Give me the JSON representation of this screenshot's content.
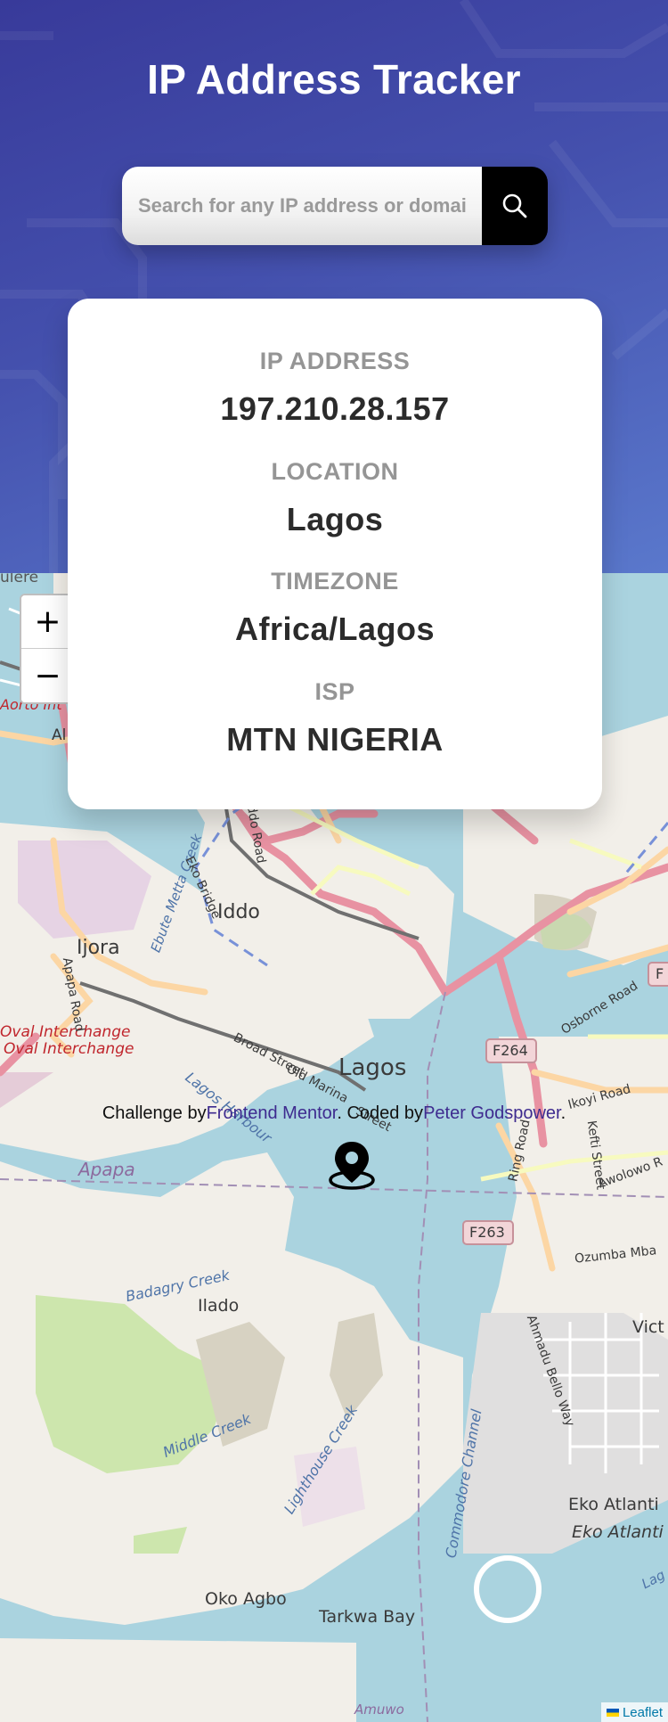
{
  "header": {
    "title": "IP Address Tracker",
    "search_placeholder": "Search for any IP address or domain",
    "search_button_icon": "search-icon"
  },
  "info": {
    "ip_label": "IP ADDRESS",
    "ip_value": "197.210.28.157",
    "location_label": "LOCATION",
    "location_value": "Lagos",
    "timezone_label": "TIMEZONE",
    "timezone_value": "Africa/Lagos",
    "isp_label": "ISP",
    "isp_value": "MTN NIGERIA"
  },
  "map": {
    "zoom_in": "+",
    "zoom_out": "−",
    "marker_icon": "location-pin-icon",
    "labels": {
      "iddo": "Iddo",
      "ijora": "Ijora",
      "lagos": "Lagos",
      "apapa": "Apapa",
      "ilado": "Ilado",
      "oko_agbo": "Oko Agbo",
      "tarkwa_bay": "Tarkwa Bay",
      "eko_atlantic_1": "Eko Atlanti",
      "eko_atlantic_2": "Eko Atlanti",
      "victoria": "Vict",
      "oval_interchange_1": "Oval Interchange",
      "oval_interchange_2": "Oval Interchange",
      "aorto": "Aorto Int",
      "al": "Al",
      "f264": "F264",
      "f263": "F263",
      "f_partial": "F",
      "badagry_creek": "Badagry Creek",
      "middle_creek": "Middle Creek",
      "lighthouse_creek": "Lighthouse Creek",
      "commodore_channel": "Commodore Channel",
      "lagos_harbour": "Lagos Harbour",
      "ebute_metta_creek": "Ebute Metta Creek",
      "eko_bridge": "Eko Bridge",
      "iddo_road": "Iddo Road",
      "apapa_road": "Apapa Road",
      "broad_street": "Broad Street",
      "old_marina": "Old Marina",
      "street": "Street",
      "ring_road": "Ring Road",
      "osborne_road": "Osborne Road",
      "ikoyi_road": "Ikoyi Road",
      "kefti_street": "Kefti Street",
      "awolowo_road": "Awolowo R",
      "ozumba_mbadiwe": "Ozumba Mba",
      "ahmadu_bello_way": "Ahmadu Bello Way",
      "amuwo": "Amuwo",
      "lag": "Lag",
      "ulere": "ulere"
    }
  },
  "footer": {
    "challenge_prefix": "Challenge by",
    "challenge_link": "Frontend Mentor",
    "coded_prefix": ". Coded by",
    "coded_link": "Peter Godspower",
    "end": "."
  },
  "leaflet": {
    "label": "Leaflet"
  },
  "colors": {
    "header_dark": "#383a9a",
    "header_light": "#5a78cc",
    "water": "#aad3df",
    "land": "#f2efe9",
    "primary_road": "#e892a2",
    "secondary_road": "#fcd6a4",
    "link": "#3e2b8f"
  }
}
